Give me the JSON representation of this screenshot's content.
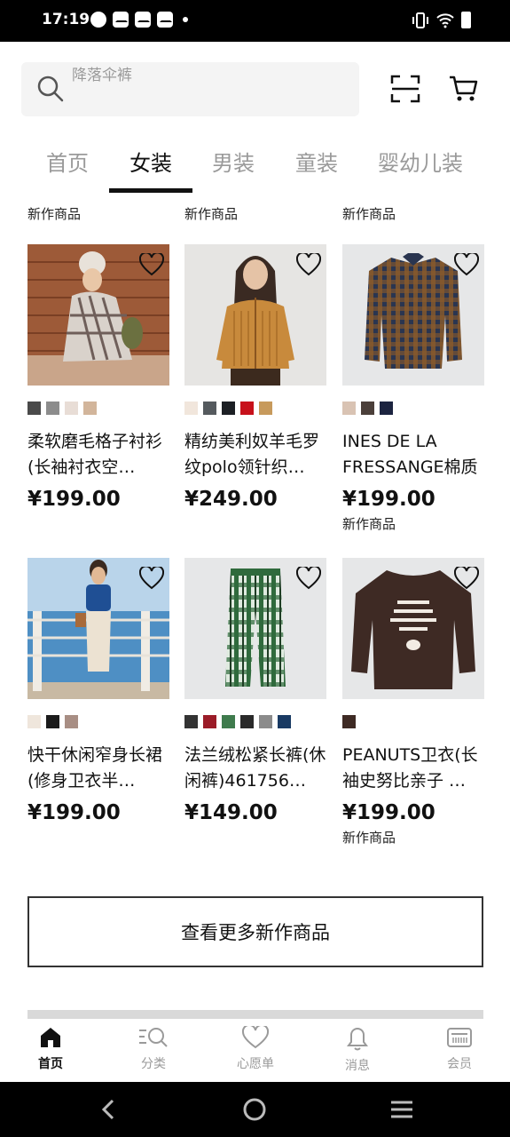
{
  "status_bar": {
    "time": "17:19"
  },
  "search": {
    "placeholder": "降落伞裤"
  },
  "tabs": [
    {
      "label": "首页",
      "active": false
    },
    {
      "label": "女装",
      "active": true
    },
    {
      "label": "男装",
      "active": false
    },
    {
      "label": "童装",
      "active": false
    },
    {
      "label": "婴幼儿装",
      "active": false
    }
  ],
  "section_badge": "新作商品",
  "products": [
    {
      "name": "柔软磨毛格子衬衫(长袖衬衣空…",
      "price": "¥199.00",
      "badge": "",
      "swatches": [
        "#4a4a4a",
        "#8c8c8c",
        "#e8ddd6",
        "#d2b59b"
      ]
    },
    {
      "name": "精纺美利奴羊毛罗纹polo领针织…",
      "price": "¥249.00",
      "badge": "",
      "swatches": [
        "#f1e6dc",
        "#555a5e",
        "#1c1f24",
        "#c7111b",
        "#c79a5c"
      ]
    },
    {
      "name": "INES DE LA FRESSANGE棉质格…",
      "price": "¥199.00",
      "badge": "新作商品",
      "swatches": [
        "#d9c3b3",
        "#4b3f3a",
        "#1c2440"
      ]
    },
    {
      "name": "快干休闲窄身长裙(修身卫衣半…",
      "price": "¥199.00",
      "badge": "",
      "swatches": [
        "#efe6dc",
        "#1b1b1b",
        "#a88e84"
      ]
    },
    {
      "name": "法兰绒松紧长裤(休闲裤)461756…",
      "price": "¥149.00",
      "badge": "",
      "swatches": [
        "#333333",
        "#9b1c28",
        "#3f7b4d",
        "#2a2a2a",
        "#8b8b8b",
        "#193a63"
      ]
    },
    {
      "name": "PEANUTS卫衣(长袖史努比亲子 …",
      "price": "¥199.00",
      "badge": "新作商品",
      "swatches": [
        "#3e2a24"
      ]
    }
  ],
  "more_button": "查看更多新作商品",
  "bottom_nav": [
    {
      "label": "首页",
      "icon": "home-icon",
      "active": true
    },
    {
      "label": "分类",
      "icon": "category-search-icon",
      "active": false
    },
    {
      "label": "心愿单",
      "icon": "heart-icon",
      "active": false
    },
    {
      "label": "消息",
      "icon": "bell-icon",
      "active": false
    },
    {
      "label": "会员",
      "icon": "member-card-icon",
      "active": false
    }
  ]
}
